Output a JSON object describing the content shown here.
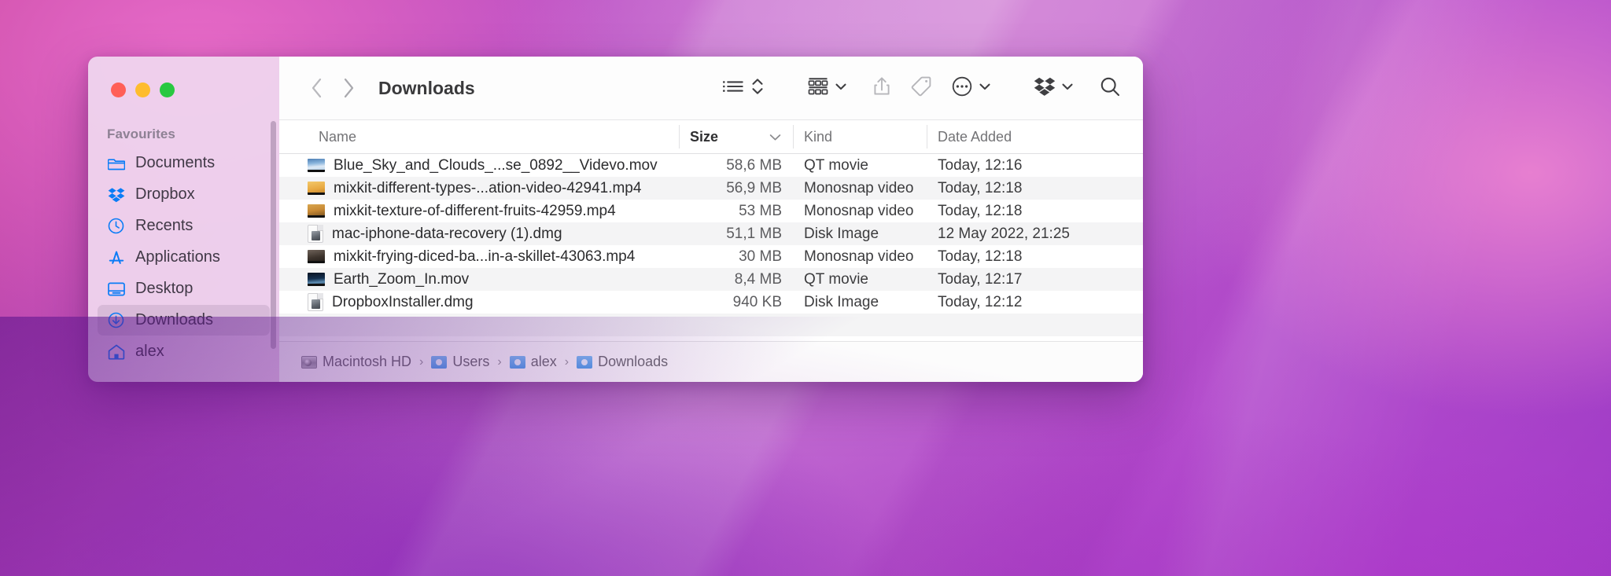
{
  "window": {
    "title": "Downloads",
    "traffic_lights": [
      "close",
      "minimize",
      "zoom"
    ]
  },
  "sidebar": {
    "section_title": "Favourites",
    "items": [
      {
        "label": "Documents",
        "icon": "folder-icon",
        "selected": false
      },
      {
        "label": "Dropbox",
        "icon": "dropbox-icon",
        "selected": false
      },
      {
        "label": "Recents",
        "icon": "clock-icon",
        "selected": false
      },
      {
        "label": "Applications",
        "icon": "appstore-icon",
        "selected": false
      },
      {
        "label": "Desktop",
        "icon": "desktop-icon",
        "selected": false
      },
      {
        "label": "Downloads",
        "icon": "download-icon",
        "selected": true
      },
      {
        "label": "alex",
        "icon": "home-icon",
        "selected": false
      }
    ]
  },
  "toolbar": {
    "back_icon": "chevron-left-icon",
    "forward_icon": "chevron-right-icon",
    "view_list_icon": "list-view-icon",
    "view_sort_icon": "sort-updown-icon",
    "group_icon": "group-by-icon",
    "group_chevron_icon": "chevron-down-icon",
    "share_icon": "share-icon",
    "tag_icon": "tag-icon",
    "more_icon": "ellipsis-circle-icon",
    "more_chevron_icon": "chevron-down-icon",
    "dropbox_icon": "dropbox-icon",
    "dropbox_chevron_icon": "chevron-down-icon",
    "search_icon": "search-icon"
  },
  "columns": [
    {
      "key": "name",
      "label": "Name",
      "sorted": false
    },
    {
      "key": "size",
      "label": "Size",
      "sorted": true,
      "sort_chevron": "chevron-down-icon"
    },
    {
      "key": "kind",
      "label": "Kind",
      "sorted": false
    },
    {
      "key": "date",
      "label": "Date Added",
      "sorted": false
    }
  ],
  "files": [
    {
      "name": "Blue_Sky_and_Clouds_...se_0892__Videvo.mov",
      "size": "58,6 MB",
      "kind": "QT movie",
      "date": "Today, 12:16",
      "thumb": "sky-thumb"
    },
    {
      "name": "mixkit-different-types-...ation-video-42941.mp4",
      "size": "56,9 MB",
      "kind": "Monosnap video",
      "date": "Today, 12:18",
      "thumb": "food-thumb"
    },
    {
      "name": "mixkit-texture-of-different-fruits-42959.mp4",
      "size": "53 MB",
      "kind": "Monosnap video",
      "date": "Today, 12:18",
      "thumb": "fruit-thumb"
    },
    {
      "name": "mac-iphone-data-recovery (1).dmg",
      "size": "51,1 MB",
      "kind": "Disk Image",
      "date": "12 May 2022, 21:25",
      "thumb": "dmg-icon"
    },
    {
      "name": "mixkit-frying-diced-ba...in-a-skillet-43063.mp4",
      "size": "30 MB",
      "kind": "Monosnap video",
      "date": "Today, 12:18",
      "thumb": "pan-thumb"
    },
    {
      "name": "Earth_Zoom_In.mov",
      "size": "8,4 MB",
      "kind": "QT movie",
      "date": "Today, 12:17",
      "thumb": "earth-thumb"
    },
    {
      "name": "DropboxInstaller.dmg",
      "size": "940 KB",
      "kind": "Disk Image",
      "date": "Today, 12:12",
      "thumb": "dmg-icon"
    }
  ],
  "path_bar": {
    "segments": [
      {
        "label": "Macintosh HD",
        "icon": "harddisk-icon"
      },
      {
        "label": "Users",
        "icon": "folder-icon"
      },
      {
        "label": "alex",
        "icon": "home-folder-icon"
      },
      {
        "label": "Downloads",
        "icon": "downloads-folder-icon"
      }
    ],
    "separator": "›"
  },
  "colors": {
    "accent_blue": "#0a7cf6",
    "sidebar_bg": "#efd6ee",
    "close": "#ff5f57",
    "minimize": "#febc2e",
    "zoom": "#28c840"
  }
}
